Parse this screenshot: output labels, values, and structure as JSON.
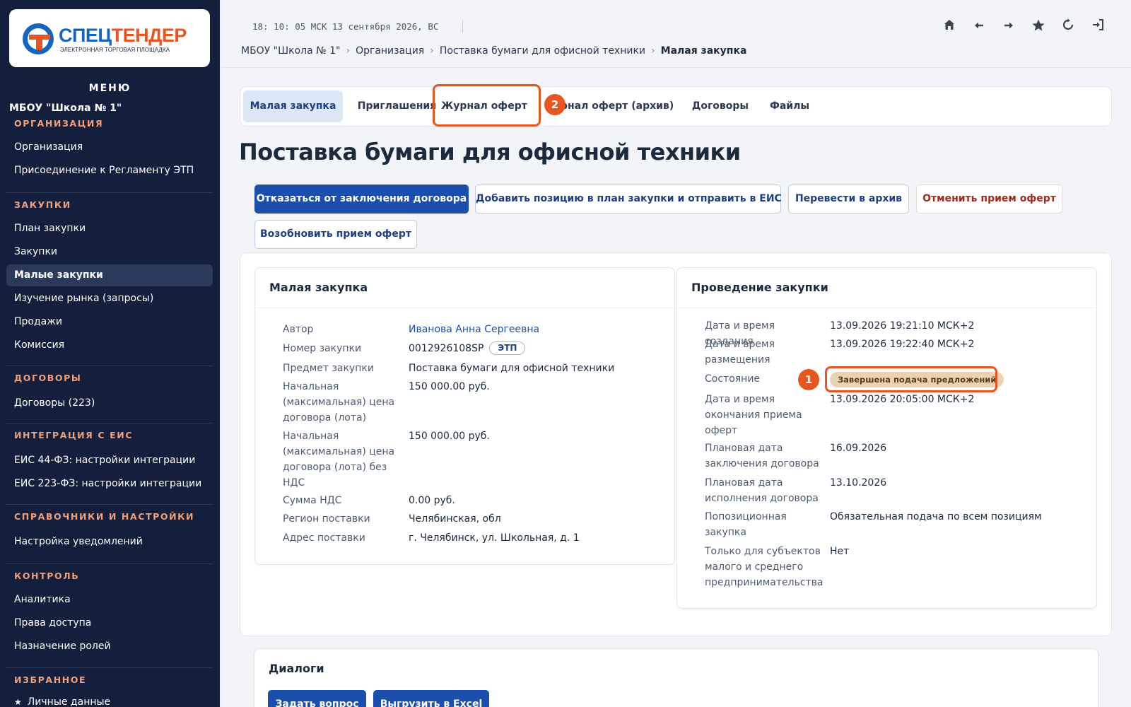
{
  "logo": {
    "part1": "СПЕЦ",
    "part2": "ТЕНДЕР",
    "subtitle": "ЭЛЕКТРОННАЯ ТОРГОВАЯ ПЛОЩАДКА"
  },
  "sidebar": {
    "menu_title": "МЕНЮ",
    "org_name": "МБОУ \"Школа № 1\"",
    "sections": [
      {
        "title": "ОРГАНИЗАЦИЯ",
        "items": [
          "Организация",
          "Присоединение к Регламенту ЭТП"
        ]
      },
      {
        "title": "ЗАКУПКИ",
        "items": [
          "План закупки",
          "Закупки",
          "Малые закупки",
          "Изучение рынка (запросы)",
          "Продажи",
          "Комиссия"
        ]
      },
      {
        "title": "ДОГОВОРЫ",
        "items": [
          "Договоры (223)"
        ]
      },
      {
        "title": "ИНТЕГРАЦИЯ С ЕИС",
        "items": [
          "ЕИС 44-ФЗ: настройки интеграции",
          "ЕИС 223-ФЗ: настройки интеграции"
        ]
      },
      {
        "title": "СПРАВОЧНИКИ И НАСТРОЙКИ",
        "items": [
          "Настройка уведомлений"
        ]
      },
      {
        "title": "КОНТРОЛЬ",
        "items": [
          "Аналитика",
          "Права доступа",
          "Назначение ролей"
        ]
      },
      {
        "title": "ИЗБРАННОЕ",
        "items": [
          "Личные данные"
        ]
      }
    ],
    "active_item": "Малые закупки"
  },
  "topbar": {
    "clock": "18: 10: 05 МСК  13 сентября 2026, ВС",
    "icons": [
      "home-icon",
      "arrow-left-icon",
      "arrow-right-icon",
      "star-icon",
      "refresh-icon",
      "logout-icon"
    ]
  },
  "breadcrumb": [
    "МБОУ \"Школа № 1\"",
    "Организация",
    "Поставка бумаги для офисной техники",
    "Малая закупка"
  ],
  "tabs": [
    "Малая закупка",
    "Приглашения",
    "Журнал оферт",
    "Журнал оферт (архив)",
    "Договоры",
    "Файлы"
  ],
  "tabs_visible": {
    "archive": "рнал оферт (архив)"
  },
  "page_title": "Поставка бумаги для офисной техники",
  "actions": {
    "decline_contract": "Отказаться от заключения договора",
    "add_to_plan": "Добавить позицию в план закупки и отправить в ЕИС",
    "archive": "Перевести в архив",
    "cancel_offers": "Отменить прием оферт",
    "resume_offers": "Возобновить прием оферт"
  },
  "small_purchase": {
    "title": "Малая закупка",
    "rows": [
      {
        "label": "Автор",
        "value": "Иванова Анна Сергеевна"
      },
      {
        "label": "Номер закупки",
        "value": "0012926108SP",
        "badge": "ЭТП"
      },
      {
        "label": "Предмет закупки",
        "value": "Поставка бумаги для офисной техники"
      },
      {
        "label": "Начальная (максимальная) цена договора (лота)",
        "value": "150 000.00 руб."
      },
      {
        "label": "Начальная (максимальная) цена договора (лота) без НДС",
        "value": "150 000.00 руб."
      },
      {
        "label": "Сумма НДС",
        "value": "0.00 руб."
      },
      {
        "label": "Регион поставки",
        "value": "Челябинская, обл"
      },
      {
        "label": "Адрес поставки",
        "value": "г. Челябинск, ул. Школьная, д. 1"
      }
    ]
  },
  "conduct": {
    "title": "Проведение закупки",
    "rows": [
      {
        "label": "Дата и время создания",
        "value": "13.09.2026 19:21:10 МСК+2"
      },
      {
        "label": "Дата и время размещения",
        "value": "13.09.2026 19:22:40 МСК+2"
      },
      {
        "label": "Состояние",
        "value": "Завершена подача предложений"
      },
      {
        "label": "Дата и время окончания приема оферт",
        "value": "13.09.2026 20:05:00 МСК+2"
      },
      {
        "label": "Плановая дата заключения договора",
        "value": "16.09.2026"
      },
      {
        "label": "Плановая дата исполнения договора",
        "value": "13.10.2026"
      },
      {
        "label": "Попозиционная закупка",
        "value": "Обязательная подача по всем позициям"
      },
      {
        "label": "Только для субъектов малого и среднего предпринимательства",
        "value": "Нет"
      }
    ]
  },
  "dialogs": {
    "title": "Диалоги",
    "ask": "Задать вопрос",
    "export": "Выгрузить в Excel"
  },
  "annotations": {
    "marker1": "1",
    "marker2": "2"
  },
  "colors": {
    "sidebar_bg": "#131f3c",
    "accent": "#1c4fad",
    "highlight": "#e8561f",
    "section_title": "#f2a079",
    "status_chip": "#e9d3b3"
  }
}
